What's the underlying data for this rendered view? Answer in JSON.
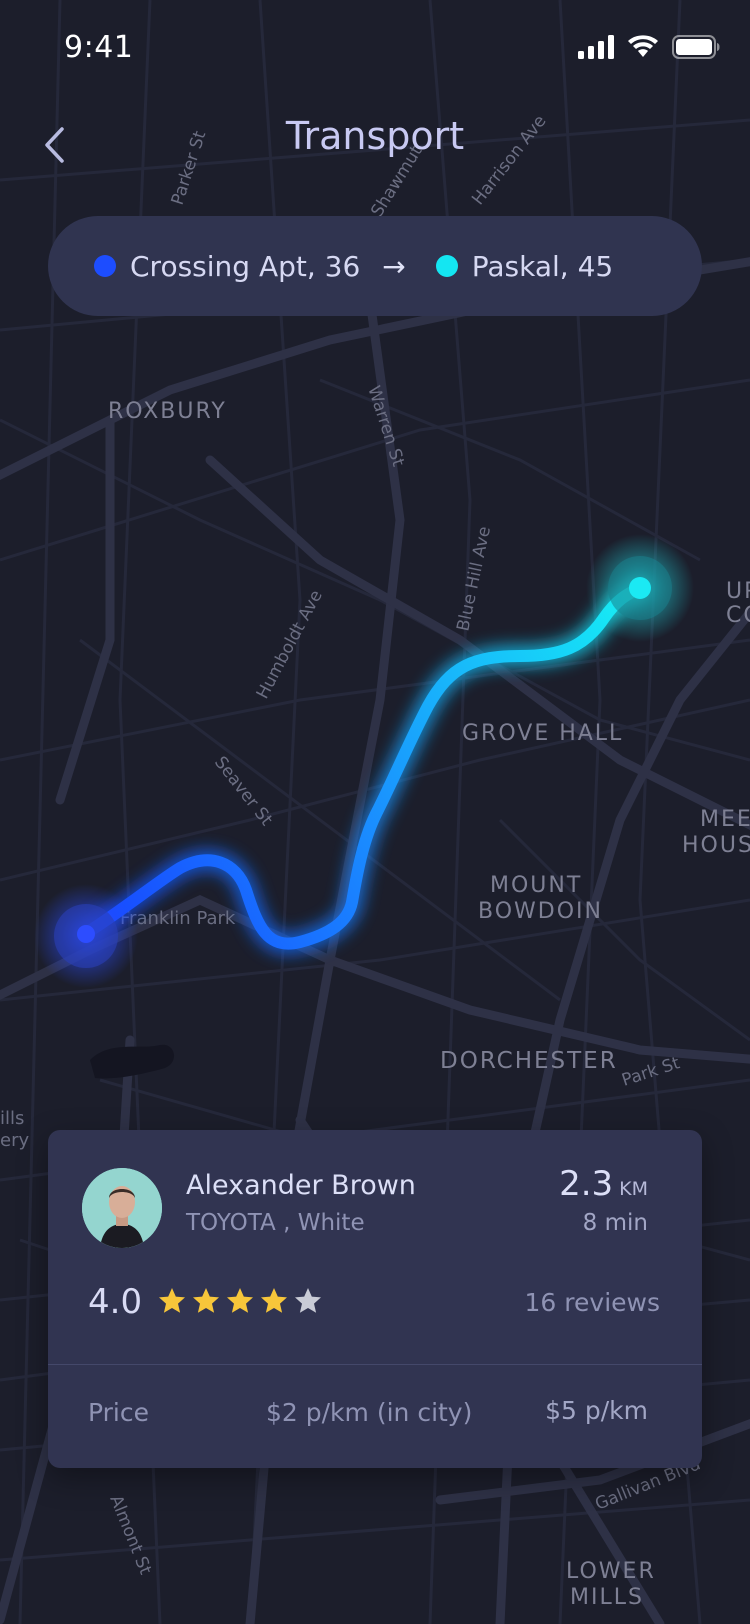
{
  "status_bar": {
    "time": "9:41"
  },
  "header": {
    "title": "Transport",
    "back_icon": "chevron-left-icon"
  },
  "route": {
    "from_label": "Crossing Apt, 36",
    "from_color": "#1d4dff",
    "arrow": "→",
    "to_label": "Paskal, 45",
    "to_color": "#14e6f2"
  },
  "map": {
    "areas": [
      "ROXBURY",
      "GROVE HALL",
      "MOUNT",
      "BOWDOIN",
      "DORCHESTER",
      "UP",
      "CO",
      "MEET",
      "HOUSE",
      "LOWER",
      "MILLS"
    ],
    "streets": [
      "Warren St",
      "Blue Hill Ave",
      "Humboldt Ave",
      "Seaver St",
      "Franklin Park",
      "Park St",
      "Almont St",
      "Gallivan Blvd",
      "Harrison Ave",
      "Parker St",
      "Shawmut",
      "ills",
      "ery",
      "KM"
    ],
    "route_start_color": "#1744ff",
    "route_end_color": "#15f0f5"
  },
  "driver": {
    "name": "Alexander Brown",
    "car": "TOYOTA , White",
    "distance_value": "2.3",
    "distance_unit": "KM",
    "duration": "8 min",
    "rating": "4.0",
    "rating_stars": 4,
    "reviews": "16 reviews",
    "price_label": "Price",
    "price_city": "$2 p/km (in city)",
    "price_outside": "$5 p/km",
    "star_color": "#f7c63a"
  }
}
